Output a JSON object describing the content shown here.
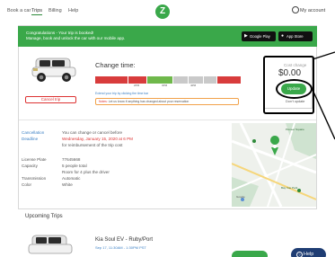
{
  "nav": {
    "items": [
      {
        "label": "Book a car",
        "active": false
      },
      {
        "label": "Trips",
        "active": true
      },
      {
        "label": "Billing",
        "active": false
      },
      {
        "label": "Help",
        "active": false
      }
    ],
    "logo": "Z",
    "account": "My account"
  },
  "banner": {
    "line1": "Congratulations - Your trip is booked!",
    "line2": "Manage, book and unlock the car with our mobile app.",
    "google_play": "Google Play",
    "app_store": "App Store"
  },
  "trip": {
    "change_time_title": "Change time:",
    "timeline_labels": [
      "2PM",
      "3PM",
      "4PM"
    ],
    "change_hint": "Extend your trip by clicking the time bar",
    "note_label": "Notes:",
    "note_text": "Let us know if anything has changed about your reservation",
    "cancel_label": "Cancel trip"
  },
  "cost": {
    "label": "Cost change",
    "value": "$0.00",
    "update_label": "Update",
    "dont_update_label": "Don't update"
  },
  "details": {
    "rows": [
      {
        "label": "Cancellation",
        "value": "You can change or cancel before"
      },
      {
        "label": "Deadline",
        "value": "Wednesday, January 15, 2020 at 6 PM",
        "value_red": true
      },
      {
        "label": "",
        "value": "for reimbursement of the trip cost"
      }
    ],
    "car_rows": [
      {
        "label": "License Plate",
        "value": "77645668"
      },
      {
        "label": "Capacity",
        "value": "5 people total"
      },
      {
        "label": "",
        "value": "Room for 4 plus the driver"
      },
      {
        "label": "Transmission",
        "value": "Automatic"
      },
      {
        "label": "Color",
        "value": "White"
      }
    ]
  },
  "map": {
    "labels": [
      "Pioneer Square",
      "Bay Vue Park",
      "Google"
    ]
  },
  "upcoming": {
    "title": "Upcoming Trips",
    "car_name": "Kia Soul EV - Ruby/Port",
    "car_sub": "Sep 17, 11:30AM - 1:30PM PST"
  },
  "help_label": "Help",
  "colors": {
    "brand_green": "#3aa84a",
    "link_blue": "#3a7fc4",
    "alert_red": "#d33333",
    "help_navy": "#1f3d73"
  }
}
